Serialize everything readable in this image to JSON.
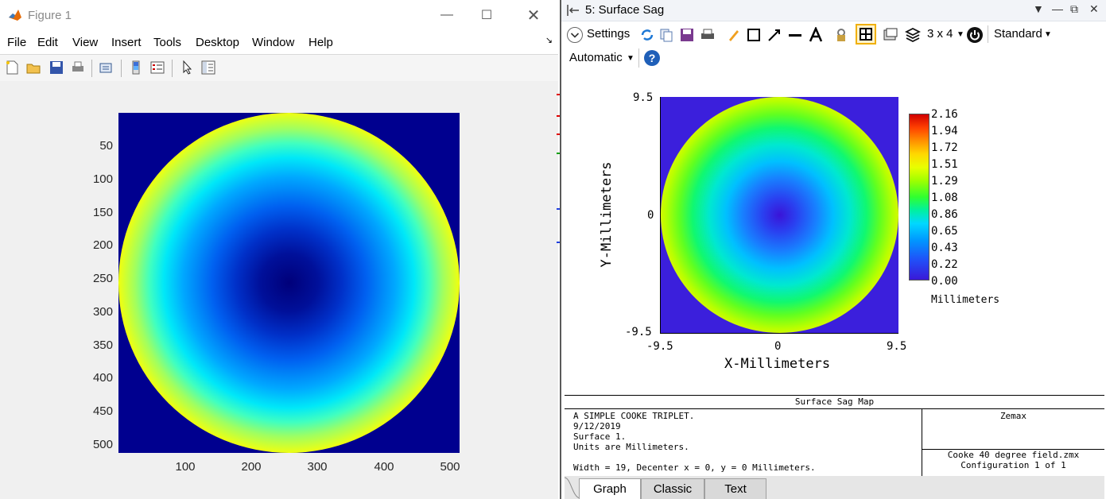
{
  "matlab": {
    "title": "Figure 1",
    "menu": [
      "File",
      "Edit",
      "View",
      "Insert",
      "Tools",
      "Desktop",
      "Window",
      "Help"
    ],
    "y_ticks": [
      "50",
      "100",
      "150",
      "200",
      "250",
      "300",
      "350",
      "400",
      "450",
      "500"
    ],
    "x_ticks": [
      "100",
      "200",
      "300",
      "400",
      "500"
    ],
    "icons": [
      "new-figure-icon",
      "open-file-icon",
      "save-icon",
      "print-icon",
      "link-plot-icon",
      "colorbar-icon",
      "legend-icon",
      "pointer-icon",
      "property-editor-icon"
    ],
    "colormap": "jet"
  },
  "zemax": {
    "window_title": "5: Surface Sag",
    "settings_label": "Settings",
    "layout_label": "3 x 4",
    "standard_label": "Standard",
    "automatic_label": "Automatic",
    "tabs": [
      "Graph",
      "Classic",
      "Text"
    ],
    "active_tab": "Graph",
    "plot": {
      "ylabel": "Y-Millimeters",
      "xlabel": "X-Millimeters",
      "y_ticks": [
        "9.5",
        "0",
        "-9.5"
      ],
      "x_ticks": [
        "-9.5",
        "0",
        "9.5"
      ],
      "colorbar_ticks": [
        "2.16",
        "1.94",
        "1.72",
        "1.51",
        "1.29",
        "1.08",
        "0.86",
        "0.65",
        "0.43",
        "0.22",
        "0.00"
      ],
      "colorbar_label": "Millimeters"
    },
    "footer": {
      "title": "Surface Sag Map",
      "lines": [
        "A SIMPLE COOKE TRIPLET.",
        "9/12/2019",
        "Surface 1.",
        "Units are Millimeters.",
        "",
        "Width = 19, Decenter x = 0, y = 0 Millimeters."
      ],
      "brand": "Zemax",
      "file": "Cooke 40 degree field.zmx",
      "config": "Configuration 1 of 1"
    }
  },
  "colors": {
    "matlab_background": "#00008f",
    "zemax_background": "#3b1fdc",
    "accent_border": "#f0b000"
  }
}
